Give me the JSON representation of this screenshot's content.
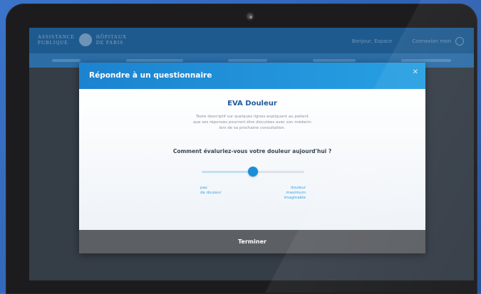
{
  "header": {
    "brand_line1": "ASSISTANCE",
    "brand_line2": "PUBLIQUE",
    "brand_line3": "HÔPITAUX",
    "brand_line4": "DE PARIS",
    "link_space": "Bonjour, Espace",
    "link_account": "Connexion mon"
  },
  "modal": {
    "title": "Répondre à un questionnaire",
    "close": "✕",
    "questionnaire_name": "EVA Douleur",
    "description_line1": "Texte descriptif sur quelques lignes expliquant au patient",
    "description_line2": "que ses réponses pourront être discutées avec son médecin",
    "description_line3": "lors de sa prochaine consultation.",
    "question": "Comment évaluriez-vous votre douleur aujourd'hui ?",
    "slider": {
      "value_fraction": 0.5,
      "min_label_line1": "pas",
      "min_label_line2": "de douleur",
      "max_label_line1": "douleur",
      "max_label_line2": "maximum",
      "max_label_line3": "imaginable"
    },
    "finish_label": "Terminer"
  },
  "colors": {
    "accent": "#1a8fd8",
    "title_blue": "#1f5a9c",
    "footer_gray": "#5c5f63"
  },
  "icons": {
    "close": "close-icon",
    "user": "user-icon"
  }
}
